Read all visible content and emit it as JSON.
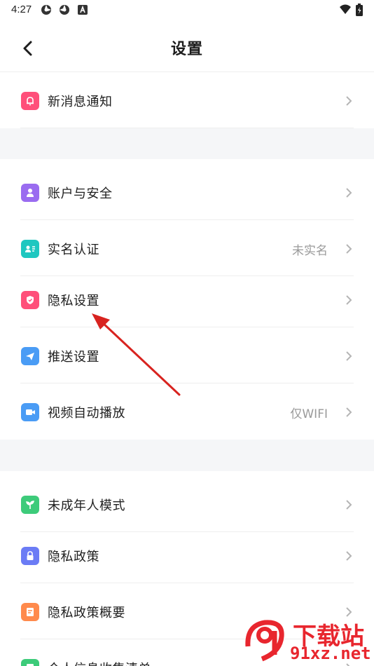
{
  "status": {
    "time": "4:27"
  },
  "nav": {
    "title": "设置"
  },
  "sections": [
    {
      "items": [
        {
          "label": "新消息通知",
          "value": "",
          "color": "#ff4f7a"
        }
      ]
    },
    {
      "items": [
        {
          "label": "账户与安全",
          "value": "",
          "color": "#9a6cf0"
        },
        {
          "label": "实名认证",
          "value": "未实名",
          "color": "#1fc7c0"
        },
        {
          "label": "隐私设置",
          "value": "",
          "color": "#ff4f7a"
        },
        {
          "label": "推送设置",
          "value": "",
          "color": "#4a9cf5"
        },
        {
          "label": "视频自动播放",
          "value": "仅WIFI",
          "color": "#4a9cf5"
        }
      ]
    },
    {
      "items": [
        {
          "label": "未成年人模式",
          "value": "",
          "color": "#3dcb7a"
        },
        {
          "label": "隐私政策",
          "value": "",
          "color": "#6b7cf5"
        },
        {
          "label": "隐私政策概要",
          "value": "",
          "color": "#ff8a4c"
        },
        {
          "label": "个人信息收集清单",
          "value": "",
          "color": "#3dcb7a"
        }
      ]
    }
  ],
  "watermark": {
    "line1": "下载站",
    "line2": "91xz.net"
  }
}
